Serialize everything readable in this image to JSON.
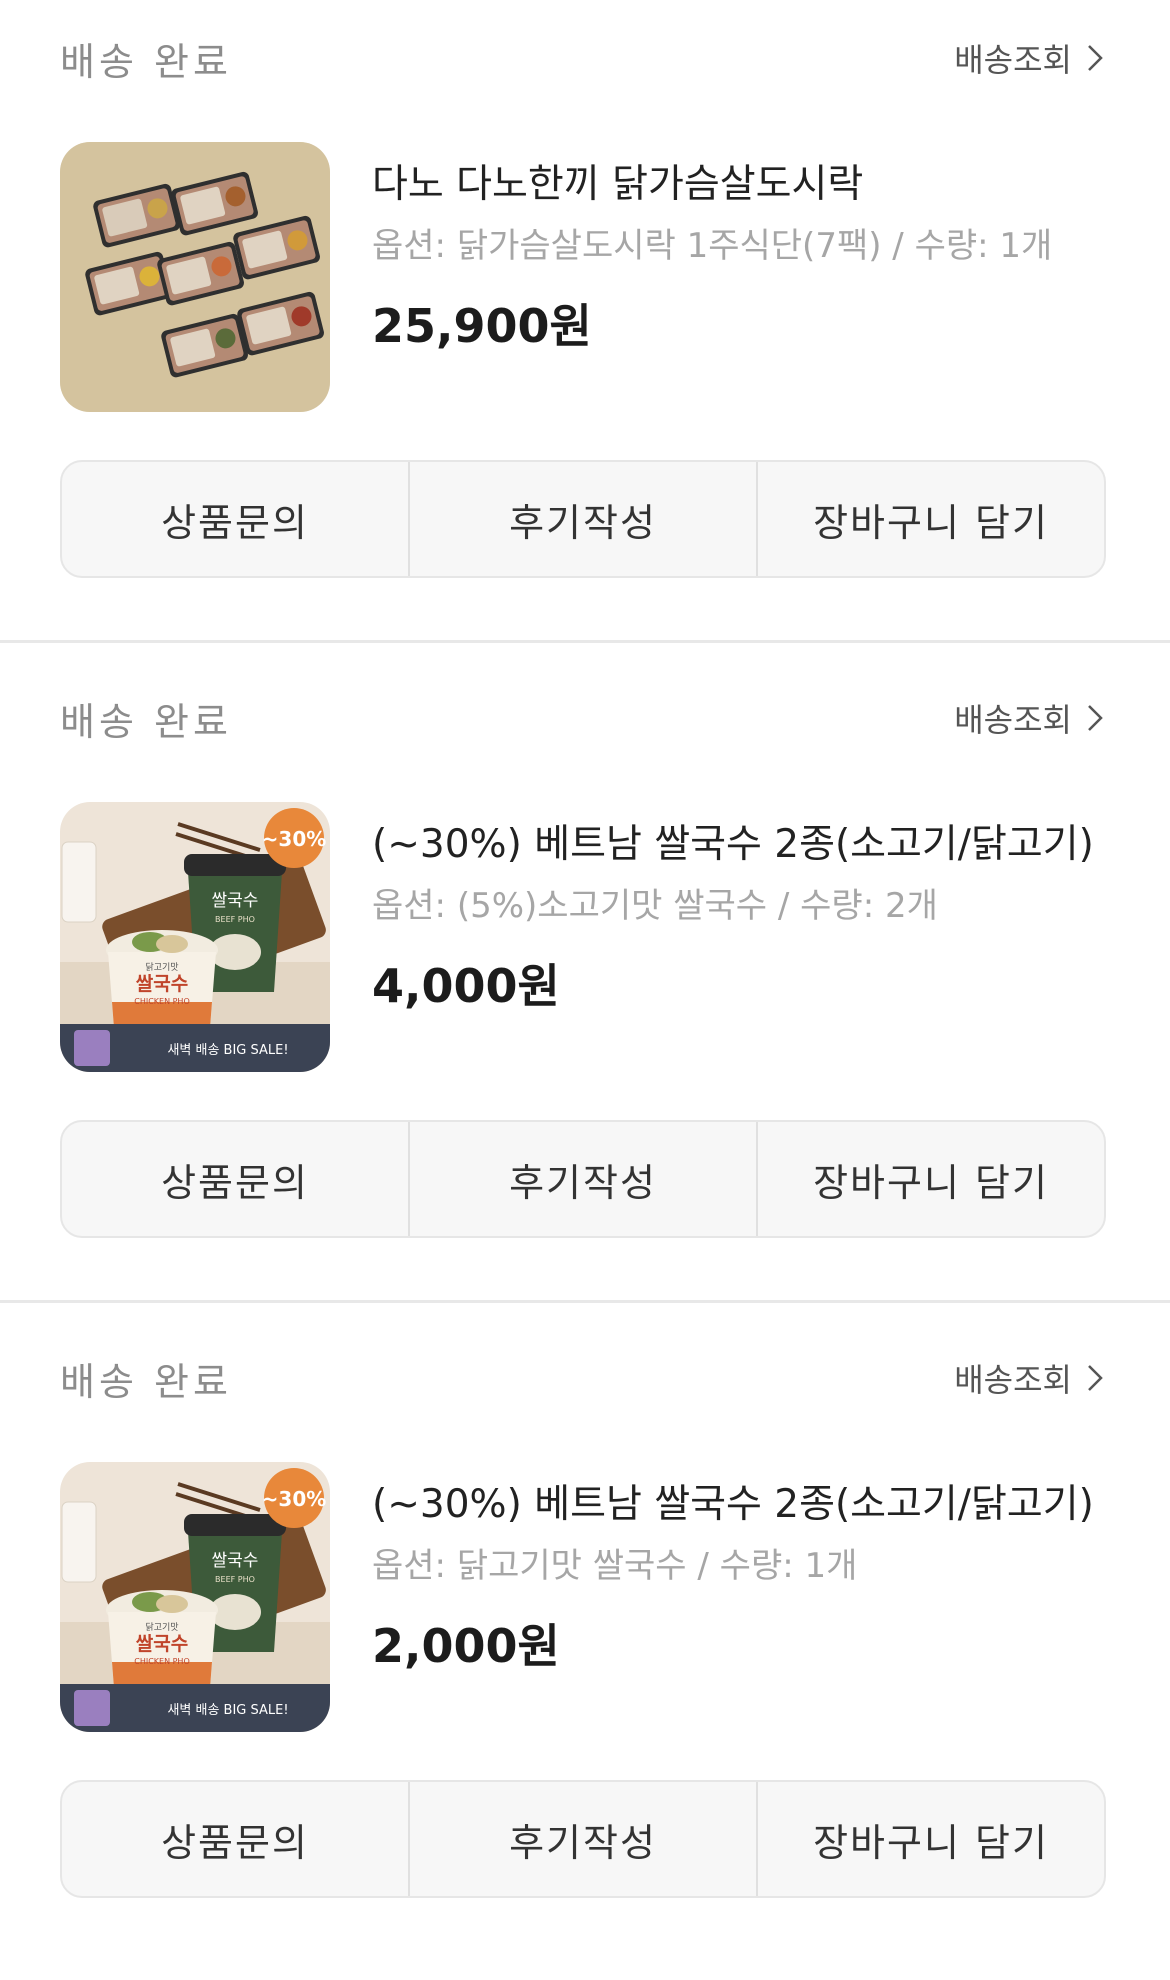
{
  "colors": {
    "status": "#8c8c8c",
    "option_text": "#a6a6a6",
    "button_bg": "#f7f7f7",
    "button_border": "#e6e6e6",
    "price": "#1c1c1c"
  },
  "orders": [
    {
      "status": "배송 완료",
      "track_label": "배송조회",
      "product_name": "다노 다노한끼 닭가슴살도시락",
      "option": "옵션: 닭가슴살도시락 1주식단(7팩) / 수량: 1개",
      "price": "25,900원",
      "image": "lunchbox-set-photo",
      "buttons": [
        "상품문의",
        "후기작성",
        "장바구니 담기"
      ]
    },
    {
      "status": "배송 완료",
      "track_label": "배송조회",
      "product_name": "(~30%) 베트남 쌀국수 2종(소고기/닭고기)",
      "option": "옵션: (5%)소고기맛 쌀국수 / 수량: 2개",
      "price": "4,000원",
      "image": "rice-noodle-cups-photo",
      "badge": "~30%",
      "banner": "새벽 배송 BIG SALE!",
      "cup_front": "쌀국수",
      "cup_front_sub": "CHICKEN PHO",
      "cup_front_top": "닭고기맛",
      "cup_back": "쌀국수",
      "cup_back_sub": "BEEF PHO",
      "buttons": [
        "상품문의",
        "후기작성",
        "장바구니 담기"
      ]
    },
    {
      "status": "배송 완료",
      "track_label": "배송조회",
      "product_name": "(~30%) 베트남 쌀국수 2종(소고기/닭고기)",
      "option": "옵션: 닭고기맛 쌀국수 / 수량: 1개",
      "price": "2,000원",
      "image": "rice-noodle-cups-photo",
      "badge": "~30%",
      "banner": "새벽 배송 BIG SALE!",
      "cup_front": "쌀국수",
      "cup_front_sub": "CHICKEN PHO",
      "cup_front_top": "닭고기맛",
      "cup_back": "쌀국수",
      "cup_back_sub": "BEEF PHO",
      "buttons": [
        "상품문의",
        "후기작성",
        "장바구니 담기"
      ]
    }
  ]
}
